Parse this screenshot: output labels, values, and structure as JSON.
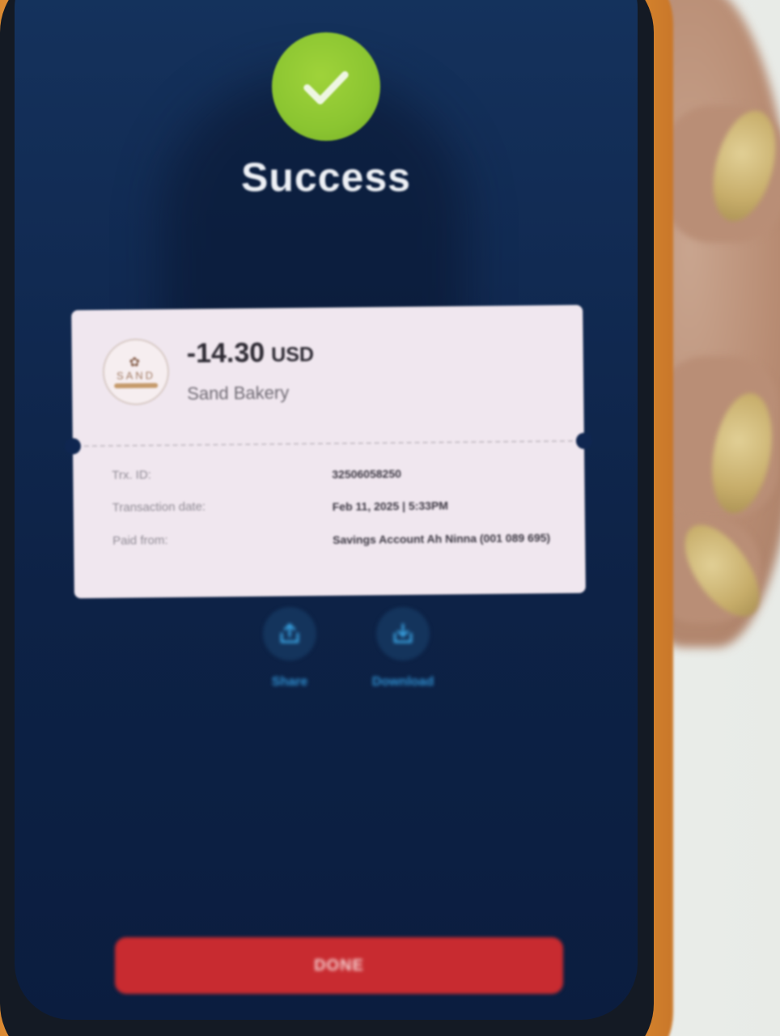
{
  "status": {
    "title": "Success",
    "icon": "check-icon",
    "icon_color": "#8bc531"
  },
  "receipt": {
    "merchant_logo_text": "SAND",
    "amount": "-14.30",
    "currency": "USD",
    "merchant_name": "Sand Bakery",
    "details": [
      {
        "label": "Trx. ID:",
        "value": "32506058250"
      },
      {
        "label": "Transaction date:",
        "value": "Feb 11, 2025 | 5:33PM"
      },
      {
        "label": "Paid from:",
        "value": "Savings Account Ah Ninna (001 089 695)"
      }
    ]
  },
  "actions": {
    "share_label": "Share",
    "download_label": "Download"
  },
  "done_button": {
    "label": "DONE",
    "color": "#c82b30"
  },
  "colors": {
    "screen_background": "#0d2246",
    "case": "#e0902f",
    "accent_link": "#2f8fd0"
  }
}
